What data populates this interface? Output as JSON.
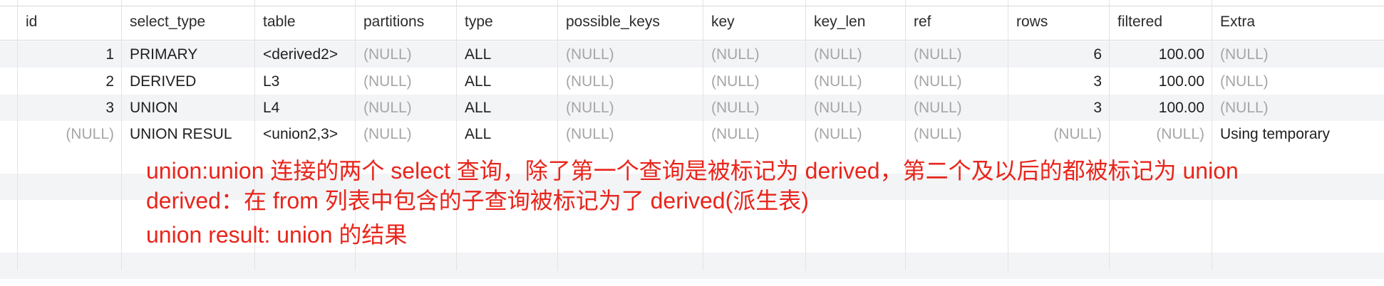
{
  "columns": [
    "id",
    "select_type",
    "table",
    "partitions",
    "type",
    "possible_keys",
    "key",
    "key_len",
    "ref",
    "rows",
    "filtered",
    "Extra"
  ],
  "rows": [
    [
      "1",
      "PRIMARY",
      "<derived2>",
      "(NULL)",
      "ALL",
      "(NULL)",
      "(NULL)",
      "(NULL)",
      "(NULL)",
      "6",
      "100.00",
      "(NULL)"
    ],
    [
      "2",
      "DERIVED",
      "L3",
      "(NULL)",
      "ALL",
      "(NULL)",
      "(NULL)",
      "(NULL)",
      "(NULL)",
      "3",
      "100.00",
      "(NULL)"
    ],
    [
      "3",
      "UNION",
      "L4",
      "(NULL)",
      "ALL",
      "(NULL)",
      "(NULL)",
      "(NULL)",
      "(NULL)",
      "3",
      "100.00",
      "(NULL)"
    ],
    [
      "(NULL)",
      "UNION RESUL",
      "<union2,3>",
      "(NULL)",
      "ALL",
      "(NULL)",
      "(NULL)",
      "(NULL)",
      "(NULL)",
      "(NULL)",
      "(NULL)",
      "Using temporary"
    ]
  ],
  "annotations": [
    "union:union 连接的两个 select 查询，除了第一个查询是被标记为 derived，第二个及以后的都被标记为 union",
    "derived：在 from 列表中包含的子查询被标记为了 derived(派生表)",
    "union result: union 的结果"
  ],
  "colors": {
    "annotation": "#e8251b",
    "null_text": "#a6a6a6",
    "stripe": "#f3f4f6"
  }
}
